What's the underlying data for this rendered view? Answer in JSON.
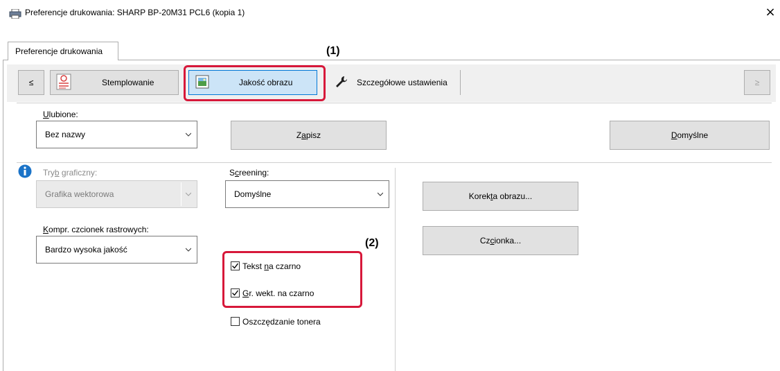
{
  "window": {
    "title": "Preferencje drukowania: SHARP BP-20M31 PCL6 (kopia 1)",
    "close_glyph": "×"
  },
  "tab": {
    "label": "Preferencje drukowania"
  },
  "toolbar": {
    "prev_label": "≤",
    "next_label": "≥",
    "stamping_label": "Stemplowanie",
    "image_quality_label": "Jakość obrazu",
    "advanced_label": "Szczegółowe ustawienia"
  },
  "favorites": {
    "label": "Ulubione:",
    "label_underline": "U",
    "label_rest": "lubione:",
    "value": "Bez nazwy",
    "save_pre": "Z",
    "save_u": "a",
    "save_post": "pisz",
    "default_u": "D",
    "default_post": "omyślne"
  },
  "graphics_mode": {
    "label_pre": "Try",
    "label_u": "b",
    "label_post": " graficzny:",
    "value": "Grafika wektorowa"
  },
  "raster_compression": {
    "label_u": "K",
    "label_post": "ompr. czcionek rastrowych:",
    "value": "Bardzo wysoka jakość"
  },
  "screening": {
    "label_pre": "S",
    "label_u": "c",
    "label_post": "reening:",
    "value": "Domyślne"
  },
  "checkboxes": {
    "text_black_pre": "Tekst ",
    "text_black_u": "n",
    "text_black_post": "a czarno",
    "vector_black_u": "G",
    "vector_black_post": "r. wekt. na czarno",
    "toner_save_label": "Oszczędzanie tonera",
    "text_black_checked": true,
    "vector_black_checked": true,
    "toner_save_checked": false
  },
  "buttons": {
    "image_correction_pre": "Korek",
    "image_correction_u": "t",
    "image_correction_post": "a obrazu...",
    "font_pre": "Cz",
    "font_u": "c",
    "font_post": "ionka..."
  },
  "annotations": {
    "one": "(1)",
    "two": "(2)"
  },
  "colors": {
    "highlight_red": "#d7183a",
    "selected_blue": "#cce4f7",
    "info_blue": "#1a73c8"
  }
}
